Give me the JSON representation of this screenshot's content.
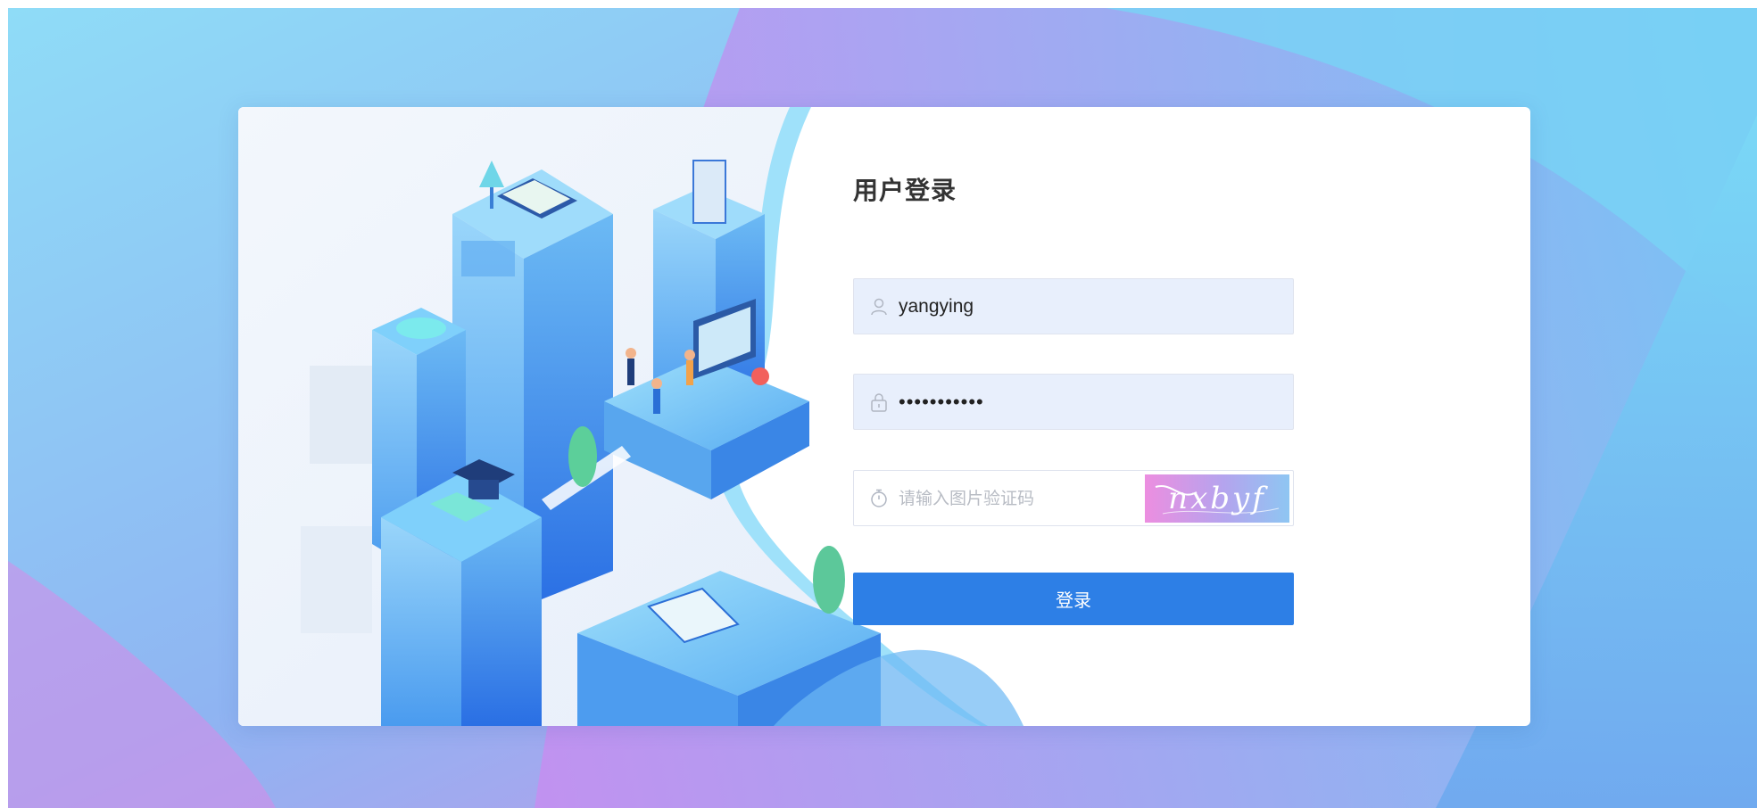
{
  "login": {
    "title": "用户登录",
    "username": {
      "value": "yangying",
      "icon": "user-icon"
    },
    "password": {
      "value": "•••••••••••",
      "icon": "lock-icon"
    },
    "captcha": {
      "placeholder": "请输入图片验证码",
      "icon": "timer-icon",
      "image_text": "nxbyf"
    },
    "submit_label": "登录"
  },
  "colors": {
    "primary": "#2d7fe6",
    "input_fill": "#e8effc",
    "title": "#333333"
  }
}
